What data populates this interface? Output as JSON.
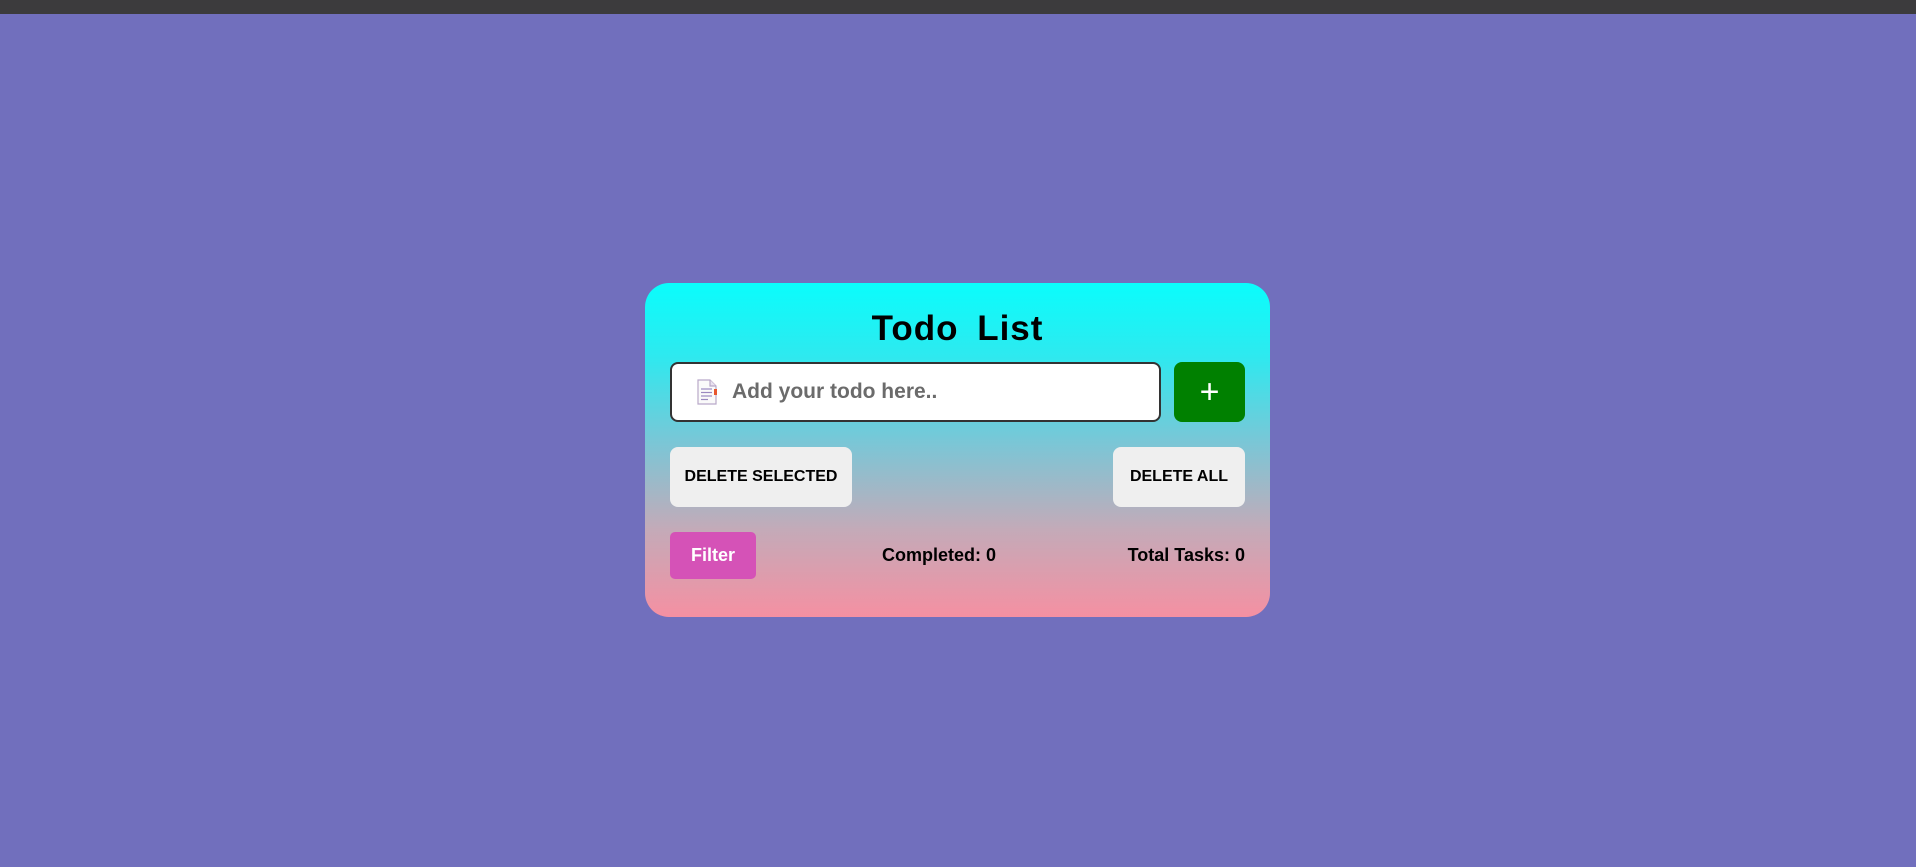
{
  "app": {
    "title": "Todo  List",
    "background_color": "#716fbd"
  },
  "input": {
    "placeholder": "Add your todo here..",
    "value": "",
    "icon": "document-icon"
  },
  "buttons": {
    "add_label": "+",
    "delete_selected_label": "DELETE SELECTED",
    "delete_all_label": "DELETE ALL",
    "filter_label": "Filter"
  },
  "stats": {
    "completed_text": "Completed: 0",
    "total_text": "Total Tasks: 0"
  },
  "colors": {
    "add_button": "#008000",
    "filter_button": "#d552b7",
    "card_gradient_top": "#0afdfc",
    "card_gradient_bottom": "#f590a2"
  }
}
